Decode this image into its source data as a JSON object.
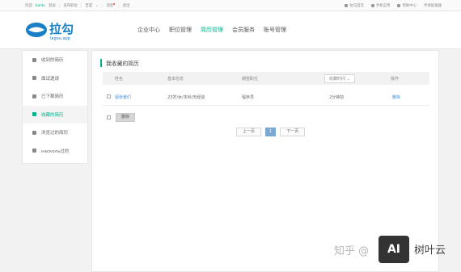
{
  "topbar": {
    "welcome": "欢迎",
    "user": "baidu",
    "login": "登录",
    "recruit_post": "发布职位",
    "sep1": "|",
    "company": "百度",
    "sep2": "|",
    "message": "消息",
    "exit": "退出",
    "links": [
      "拉勾首页",
      "手机应用",
      "帮助中心",
      "申请加速器"
    ]
  },
  "header": {
    "logo_text": "拉勾",
    "logo_sub": "lagou.app",
    "nav": [
      "企业中心",
      "职位管理",
      "简历管理",
      "会员服务",
      "账号管理"
    ],
    "active_nav": "简历管理"
  },
  "sidebar": {
    "items": [
      {
        "label": "收到的简历",
        "icon": "inbox-icon"
      },
      {
        "label": "面试邀请",
        "icon": "calendar-icon"
      },
      {
        "label": "已下载简历",
        "icon": "download-icon"
      },
      {
        "label": "收藏的简历",
        "icon": "star-icon"
      },
      {
        "label": "浏览过的简历",
        "icon": "eye-icon"
      },
      {
        "label": "насколь过的",
        "icon": "clock-icon"
      }
    ],
    "active_index": 3
  },
  "main": {
    "title": "我收藏的简历",
    "columns": {
      "name": "姓名",
      "basic": "基本信息",
      "position": "期望职位",
      "time": "收藏时间",
      "action": "操作"
    },
    "rows": [
      {
        "name": "留张者们",
        "basic": "23岁/女/本科/无经验",
        "position": "程序员",
        "time": "2分钟前",
        "action": "删除"
      }
    ],
    "delete_button": "删除",
    "pager": {
      "prev": "上一页",
      "current": "1",
      "next": "下一页"
    }
  },
  "watermark": {
    "text": "知乎 @",
    "badge": "AI",
    "brand": "树叶云"
  }
}
